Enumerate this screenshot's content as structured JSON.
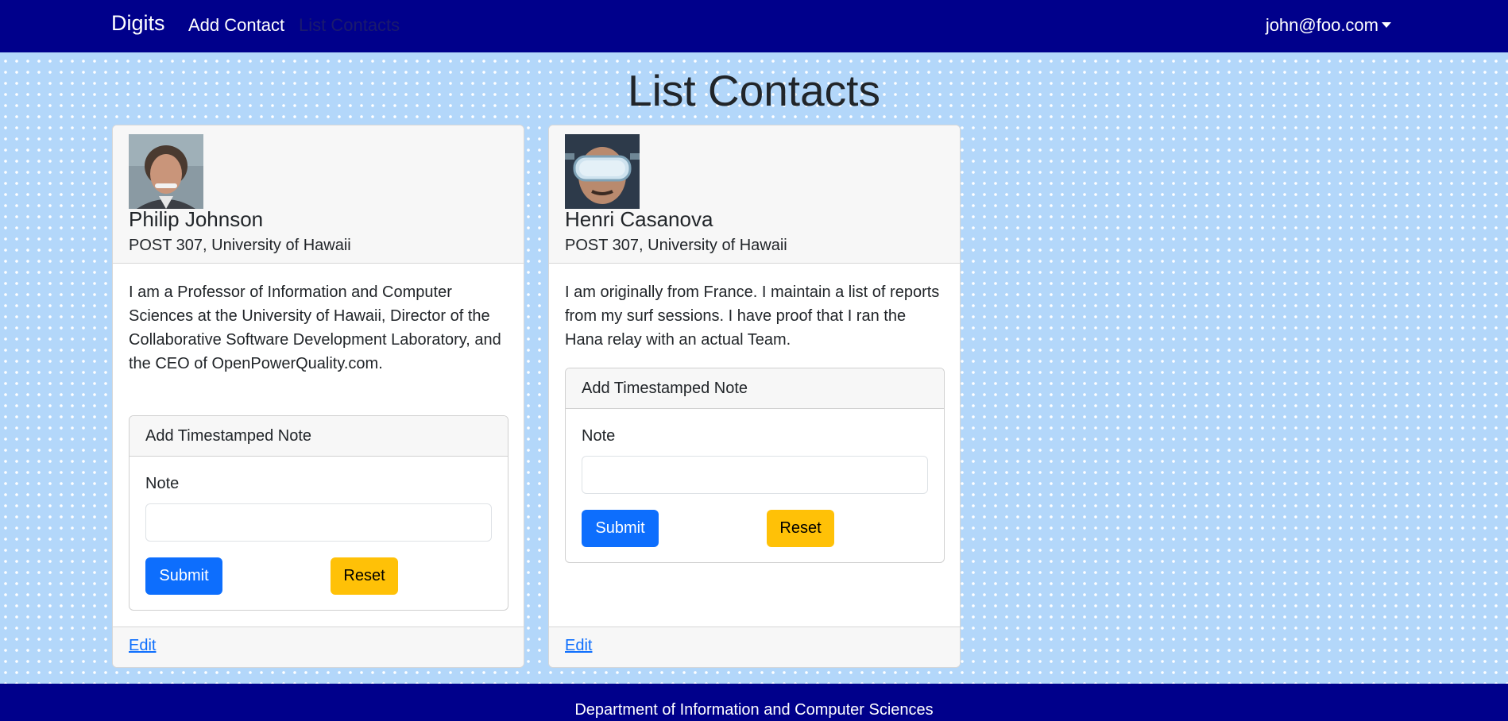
{
  "navbar": {
    "brand": "Digits",
    "links": [
      {
        "label": "Add Contact",
        "active": false
      },
      {
        "label": "List Contacts",
        "active": true
      }
    ],
    "user": "john@foo.com"
  },
  "page": {
    "title": "List Contacts"
  },
  "contacts": [
    {
      "name": "Philip Johnson",
      "address": "POST 307, University of Hawaii",
      "description": "I am a Professor of Information and Computer Sciences at the University of Hawaii, Director of the Collaborative Software Development Laboratory, and the CEO of OpenPowerQuality.com.",
      "note_form": {
        "title": "Add Timestamped Note",
        "label": "Note",
        "value": "",
        "submit": "Submit",
        "reset": "Reset"
      },
      "edit_label": "Edit"
    },
    {
      "name": "Henri Casanova",
      "address": "POST 307, University of Hawaii",
      "description": "I am originally from France. I maintain a list of reports from my surf sessions. I have proof that I ran the Hana relay with an actual Team.",
      "note_form": {
        "title": "Add Timestamped Note",
        "label": "Note",
        "value": "",
        "submit": "Submit",
        "reset": "Reset"
      },
      "edit_label": "Edit"
    }
  ],
  "footer": {
    "text": "Department of Information and Computer Sciences"
  },
  "colors": {
    "navbar_bg": "#00008b",
    "page_bg": "#b3d7fa",
    "primary": "#0d6efd",
    "warning": "#ffc107"
  }
}
